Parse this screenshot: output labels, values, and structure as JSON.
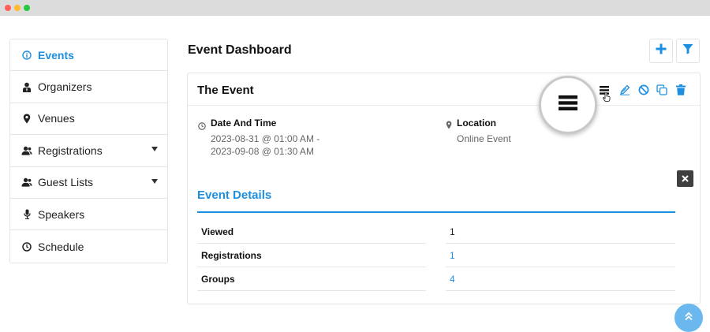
{
  "window": {
    "controls": [
      "close",
      "minimize",
      "maximize"
    ]
  },
  "sidebar": {
    "items": [
      {
        "label": "Events",
        "icon": "info-circle-icon",
        "active": true,
        "has_caret": false
      },
      {
        "label": "Organizers",
        "icon": "user-tie-icon",
        "active": false,
        "has_caret": false
      },
      {
        "label": "Venues",
        "icon": "map-pin-icon",
        "active": false,
        "has_caret": false
      },
      {
        "label": "Registrations",
        "icon": "users-icon",
        "active": false,
        "has_caret": true
      },
      {
        "label": "Guest Lists",
        "icon": "users-icon",
        "active": false,
        "has_caret": true
      },
      {
        "label": "Speakers",
        "icon": "microphone-icon",
        "active": false,
        "has_caret": false
      },
      {
        "label": "Schedule",
        "icon": "clock-icon",
        "active": false,
        "has_caret": false
      }
    ]
  },
  "header": {
    "title": "Event Dashboard",
    "add_icon": "plus-icon",
    "filter_icon": "funnel-icon"
  },
  "event": {
    "title": "The Event",
    "toolbar_icons": [
      "list-icon",
      "edit-icon",
      "ban-icon",
      "copy-icon",
      "trash-icon"
    ],
    "date_label": "Date And Time",
    "date_line1": "2023-08-31 @ 01:00 AM -",
    "date_line2": "2023-09-08 @ 01:30 AM",
    "location_label": "Location",
    "location_value": "Online Event"
  },
  "details": {
    "title": "Event Details",
    "rows": [
      {
        "label": "Viewed",
        "value": "1",
        "is_link": false
      },
      {
        "label": "Registrations",
        "value": "1",
        "is_link": true
      },
      {
        "label": "Groups",
        "value": "4",
        "is_link": true
      }
    ]
  },
  "colors": {
    "accent": "#1d8fe1",
    "muted": "#666666",
    "close_bg": "#3f3f3f",
    "scroll_btn": "#6bb8ee"
  }
}
